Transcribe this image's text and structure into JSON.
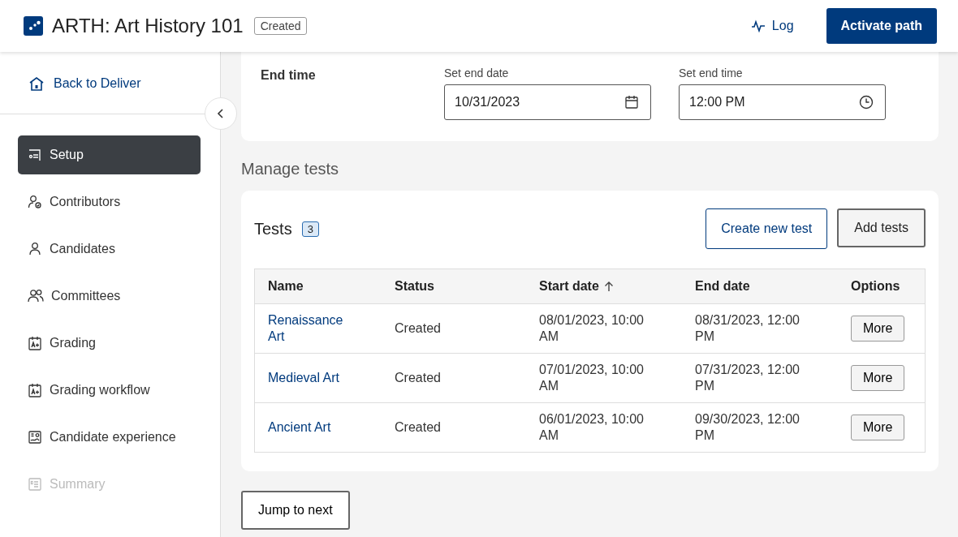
{
  "header": {
    "title": "ARTH: Art History 101",
    "status_badge": "Created",
    "log_button": "Log",
    "activate_button": "Activate path"
  },
  "sidebar": {
    "back_link": "Back to Deliver",
    "items": [
      {
        "label": "Setup",
        "kind": "setup",
        "selected": true,
        "disabled": false
      },
      {
        "label": "Contributors",
        "kind": "contributors",
        "selected": false,
        "disabled": false
      },
      {
        "label": "Candidates",
        "kind": "candidates",
        "selected": false,
        "disabled": false
      },
      {
        "label": "Committees",
        "kind": "committees",
        "selected": false,
        "disabled": false
      },
      {
        "label": "Grading",
        "kind": "grading",
        "selected": false,
        "disabled": false
      },
      {
        "label": "Grading workflow",
        "kind": "grading",
        "selected": false,
        "disabled": false
      },
      {
        "label": "Candidate experience",
        "kind": "experience",
        "selected": false,
        "disabled": false
      },
      {
        "label": "Summary",
        "kind": "summary",
        "selected": false,
        "disabled": true
      }
    ]
  },
  "end_time": {
    "label": "End time",
    "date_field": {
      "label": "Set end date",
      "value": "10/31/2023"
    },
    "time_field": {
      "label": "Set end time",
      "value": "12:00 PM"
    }
  },
  "manage_tests": {
    "heading": "Manage tests",
    "title": "Tests",
    "count": "3",
    "create_button": "Create new test",
    "add_button": "Add tests",
    "table": {
      "columns": [
        {
          "label": "Name",
          "sorted": false
        },
        {
          "label": "Status",
          "sorted": false
        },
        {
          "label": "Start date",
          "sorted": true
        },
        {
          "label": "End date",
          "sorted": false
        },
        {
          "label": "Options",
          "sorted": false
        }
      ],
      "rows": [
        {
          "name": "Renaissance Art",
          "status": "Created",
          "start_date": "08/01/2023, 10:00 AM",
          "end_date": "08/31/2023, 12:00 PM",
          "option": "More"
        },
        {
          "name": "Medieval Art",
          "status": "Created",
          "start_date": "07/01/2023, 10:00 AM",
          "end_date": "07/31/2023, 12:00 PM",
          "option": "More"
        },
        {
          "name": "Ancient Art",
          "status": "Created",
          "start_date": "06/01/2023, 10:00 AM",
          "end_date": "09/30/2023, 12:00 PM",
          "option": "More"
        }
      ]
    }
  },
  "jump_button": "Jump to next"
}
